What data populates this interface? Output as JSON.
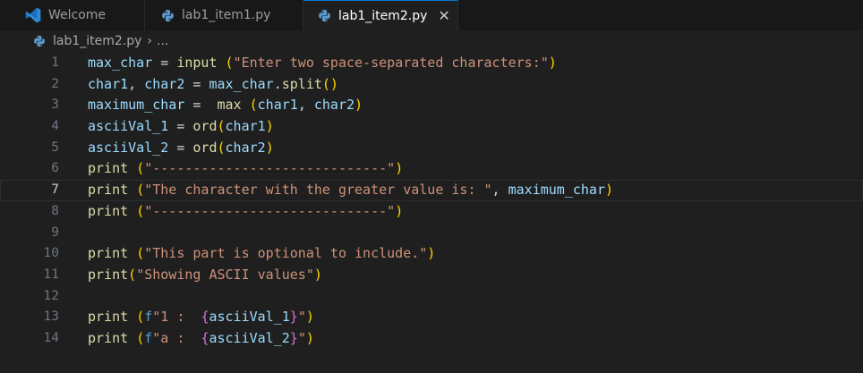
{
  "tabs": [
    {
      "label": "Welcome",
      "icon": "vscode-logo-icon",
      "active": false
    },
    {
      "label": "lab1_item1.py",
      "icon": "python-icon",
      "active": false
    },
    {
      "label": "lab1_item2.py",
      "icon": "python-icon",
      "active": true,
      "close": "✕"
    }
  ],
  "breadcrumb": {
    "file": "lab1_item2.py",
    "separator": "›",
    "more": "..."
  },
  "editor": {
    "current_line": 7,
    "lines": [
      {
        "n": "1",
        "tokens": [
          [
            "max_char",
            "var"
          ],
          [
            " = ",
            "op"
          ],
          [
            "input",
            "fn"
          ],
          [
            " ",
            "op"
          ],
          [
            "(",
            "p1"
          ],
          [
            "\"Enter two space-separated characters:\"",
            "str"
          ],
          [
            ")",
            "p1"
          ]
        ]
      },
      {
        "n": "2",
        "tokens": [
          [
            "char1",
            "var"
          ],
          [
            ", ",
            "op"
          ],
          [
            "char2",
            "var"
          ],
          [
            " = ",
            "op"
          ],
          [
            "max_char",
            "var"
          ],
          [
            ".",
            "op"
          ],
          [
            "split",
            "fn"
          ],
          [
            "()",
            "p1"
          ]
        ]
      },
      {
        "n": "3",
        "tokens": [
          [
            "maximum_char",
            "var"
          ],
          [
            " =  ",
            "op"
          ],
          [
            "max",
            "fn"
          ],
          [
            " ",
            "op"
          ],
          [
            "(",
            "p1"
          ],
          [
            "char1",
            "var"
          ],
          [
            ", ",
            "op"
          ],
          [
            "char2",
            "var"
          ],
          [
            ")",
            "p1"
          ]
        ]
      },
      {
        "n": "4",
        "tokens": [
          [
            "asciiVal_1",
            "var"
          ],
          [
            " = ",
            "op"
          ],
          [
            "ord",
            "fn"
          ],
          [
            "(",
            "p1"
          ],
          [
            "char1",
            "var"
          ],
          [
            ")",
            "p1"
          ]
        ]
      },
      {
        "n": "5",
        "tokens": [
          [
            "asciiVal_2",
            "var"
          ],
          [
            " = ",
            "op"
          ],
          [
            "ord",
            "fn"
          ],
          [
            "(",
            "p1"
          ],
          [
            "char2",
            "var"
          ],
          [
            ")",
            "p1"
          ]
        ]
      },
      {
        "n": "6",
        "tokens": [
          [
            "print",
            "fn"
          ],
          [
            " ",
            "op"
          ],
          [
            "(",
            "p1"
          ],
          [
            "\"-----------------------------\"",
            "str"
          ],
          [
            ")",
            "p1"
          ]
        ]
      },
      {
        "n": "7",
        "tokens": [
          [
            "print",
            "fn"
          ],
          [
            " ",
            "op"
          ],
          [
            "(",
            "p1"
          ],
          [
            "\"The character with the greater value is: \"",
            "str"
          ],
          [
            ", ",
            "op"
          ],
          [
            "maximum_char",
            "var"
          ],
          [
            ")",
            "p1"
          ]
        ]
      },
      {
        "n": "8",
        "tokens": [
          [
            "print",
            "fn"
          ],
          [
            " ",
            "op"
          ],
          [
            "(",
            "p1"
          ],
          [
            "\"-----------------------------\"",
            "str"
          ],
          [
            ")",
            "p1"
          ]
        ]
      },
      {
        "n": "9",
        "tokens": []
      },
      {
        "n": "10",
        "tokens": [
          [
            "print",
            "fn"
          ],
          [
            " ",
            "op"
          ],
          [
            "(",
            "p1"
          ],
          [
            "\"This part is optional to include.\"",
            "str"
          ],
          [
            ")",
            "p1"
          ]
        ]
      },
      {
        "n": "11",
        "tokens": [
          [
            "print",
            "fn"
          ],
          [
            "(",
            "p1"
          ],
          [
            "\"Showing ASCII values\"",
            "str"
          ],
          [
            ")",
            "p1"
          ]
        ]
      },
      {
        "n": "12",
        "tokens": []
      },
      {
        "n": "13",
        "tokens": [
          [
            "print",
            "fn"
          ],
          [
            " ",
            "op"
          ],
          [
            "(",
            "p1"
          ],
          [
            "f",
            "kw"
          ],
          [
            "\"1 :  ",
            "str"
          ],
          [
            "{",
            "p2"
          ],
          [
            "asciiVal_1",
            "var"
          ],
          [
            "}",
            "p2"
          ],
          [
            "\"",
            "str"
          ],
          [
            ")",
            "p1"
          ]
        ]
      },
      {
        "n": "14",
        "tokens": [
          [
            "print",
            "fn"
          ],
          [
            " ",
            "op"
          ],
          [
            "(",
            "p1"
          ],
          [
            "f",
            "kw"
          ],
          [
            "\"a :  ",
            "str"
          ],
          [
            "{",
            "p2"
          ],
          [
            "asciiVal_2",
            "var"
          ],
          [
            "}",
            "p2"
          ],
          [
            "\"",
            "str"
          ],
          [
            ")",
            "p1"
          ]
        ]
      }
    ]
  },
  "colors": {
    "accent": "#0078d4",
    "background": "#1f1f1f",
    "python": "#5c9bd1"
  }
}
